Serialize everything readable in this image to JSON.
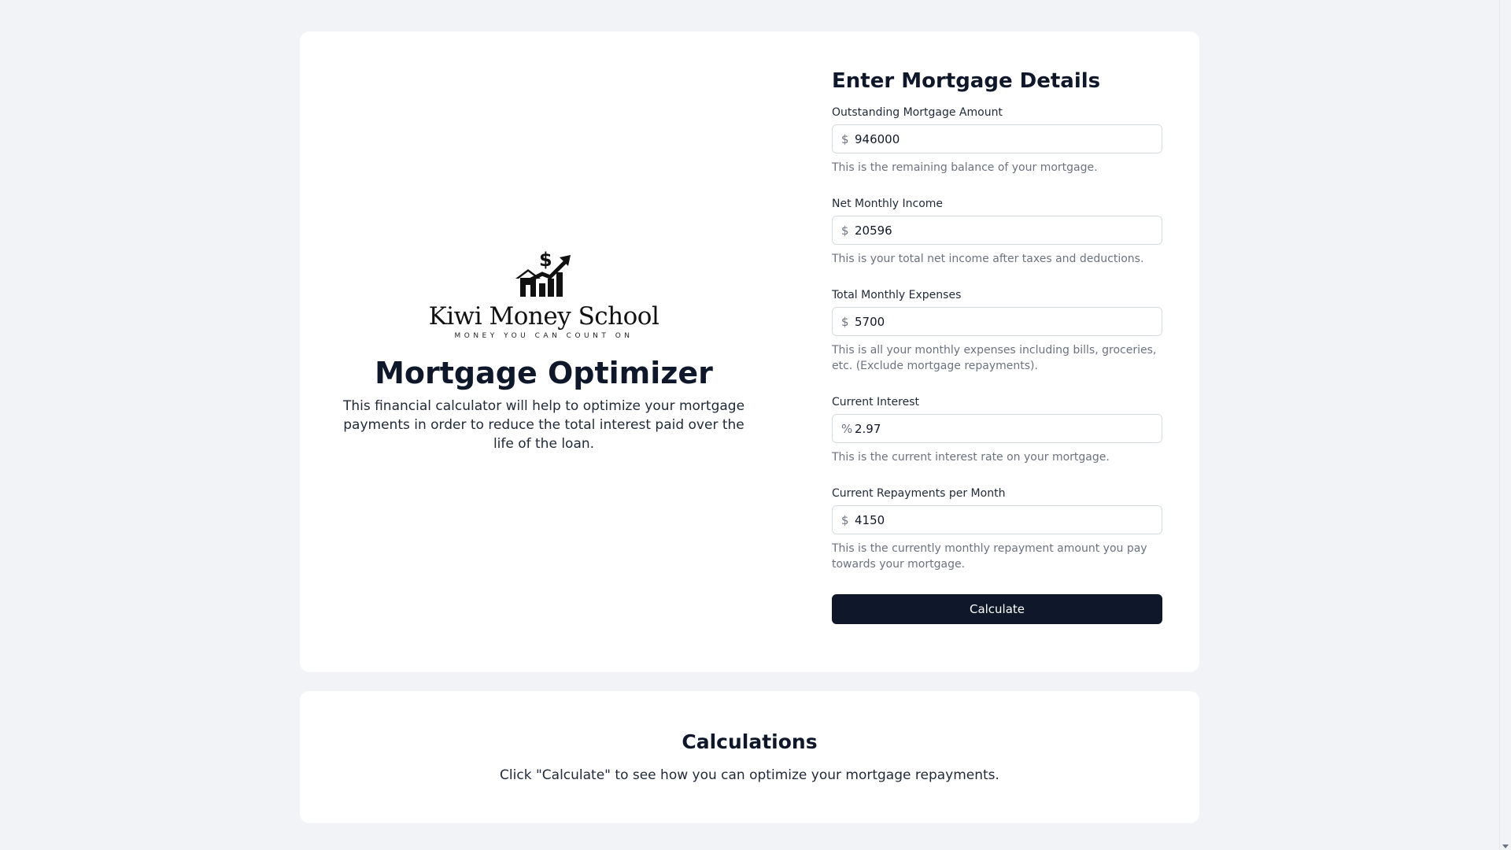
{
  "branding": {
    "logo_name": "Kiwi Money School",
    "logo_tagline": "MONEY YOU CAN COUNT ON",
    "logo_icon": "house-chart-dollar-icon"
  },
  "app": {
    "title": "Mortgage Optimizer",
    "description": "This financial calculator will help to optimize your mortgage payments in order to reduce the total interest paid over the life of the loan."
  },
  "form": {
    "title": "Enter Mortgage Details",
    "fields": [
      {
        "label": "Outstanding Mortgage Amount",
        "prefix": "$",
        "value": "946000",
        "hint": "This is the remaining balance of your mortgage."
      },
      {
        "label": "Net Monthly Income",
        "prefix": "$",
        "value": "20596",
        "hint": "This is your total net income after taxes and deductions."
      },
      {
        "label": "Total Monthly Expenses",
        "prefix": "$",
        "value": "5700",
        "hint": "This is all your monthly expenses including bills, groceries, etc. (Exclude mortgage repayments)."
      },
      {
        "label": "Current Interest",
        "prefix": "%",
        "value": "2.97",
        "hint": "This is the current interest rate on your mortgage."
      },
      {
        "label": "Current Repayments per Month",
        "prefix": "$",
        "value": "4150",
        "hint": "This is the currently monthly repayment amount you pay towards your mortgage."
      }
    ],
    "submit_label": "Calculate"
  },
  "calculations": {
    "title": "Calculations",
    "message": "Click \"Calculate\" to see how you can optimize your mortgage repayments."
  },
  "colors": {
    "background": "#f1f3f6",
    "card": "#ffffff",
    "primary": "#0f172a",
    "muted_text": "#6b7280",
    "border": "#d6dbe2"
  }
}
